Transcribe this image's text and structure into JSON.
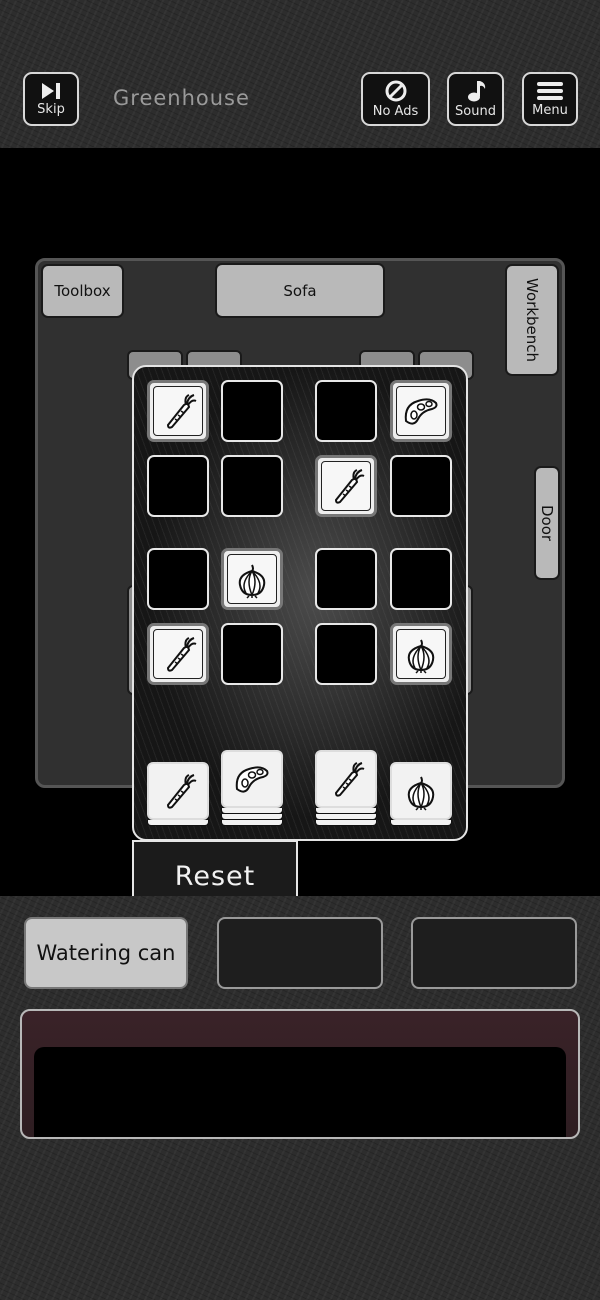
{
  "header": {
    "skip_label": "Skip",
    "title": "Greenhouse",
    "no_ads_label": "No Ads",
    "sound_label": "Sound",
    "menu_label": "Menu"
  },
  "room": {
    "toolbox": "Toolbox",
    "sofa": "Sofa",
    "workbench": "Workbench",
    "door": "Door"
  },
  "puzzle": {
    "grid": [
      [
        "carrot",
        null,
        null,
        "bean"
      ],
      [
        null,
        null,
        "carrot",
        null
      ],
      [
        null,
        "onion",
        null,
        null
      ],
      [
        "carrot",
        null,
        null,
        "onion"
      ]
    ],
    "stacks": [
      {
        "icon": "carrot",
        "count": 1
      },
      {
        "icon": "bean",
        "count": 3
      },
      {
        "icon": "carrot",
        "count": 3
      },
      {
        "icon": "onion",
        "count": 1
      }
    ],
    "reset_label": "Reset"
  },
  "inventory": {
    "slots": [
      "Watering can",
      "",
      ""
    ]
  },
  "message": ""
}
